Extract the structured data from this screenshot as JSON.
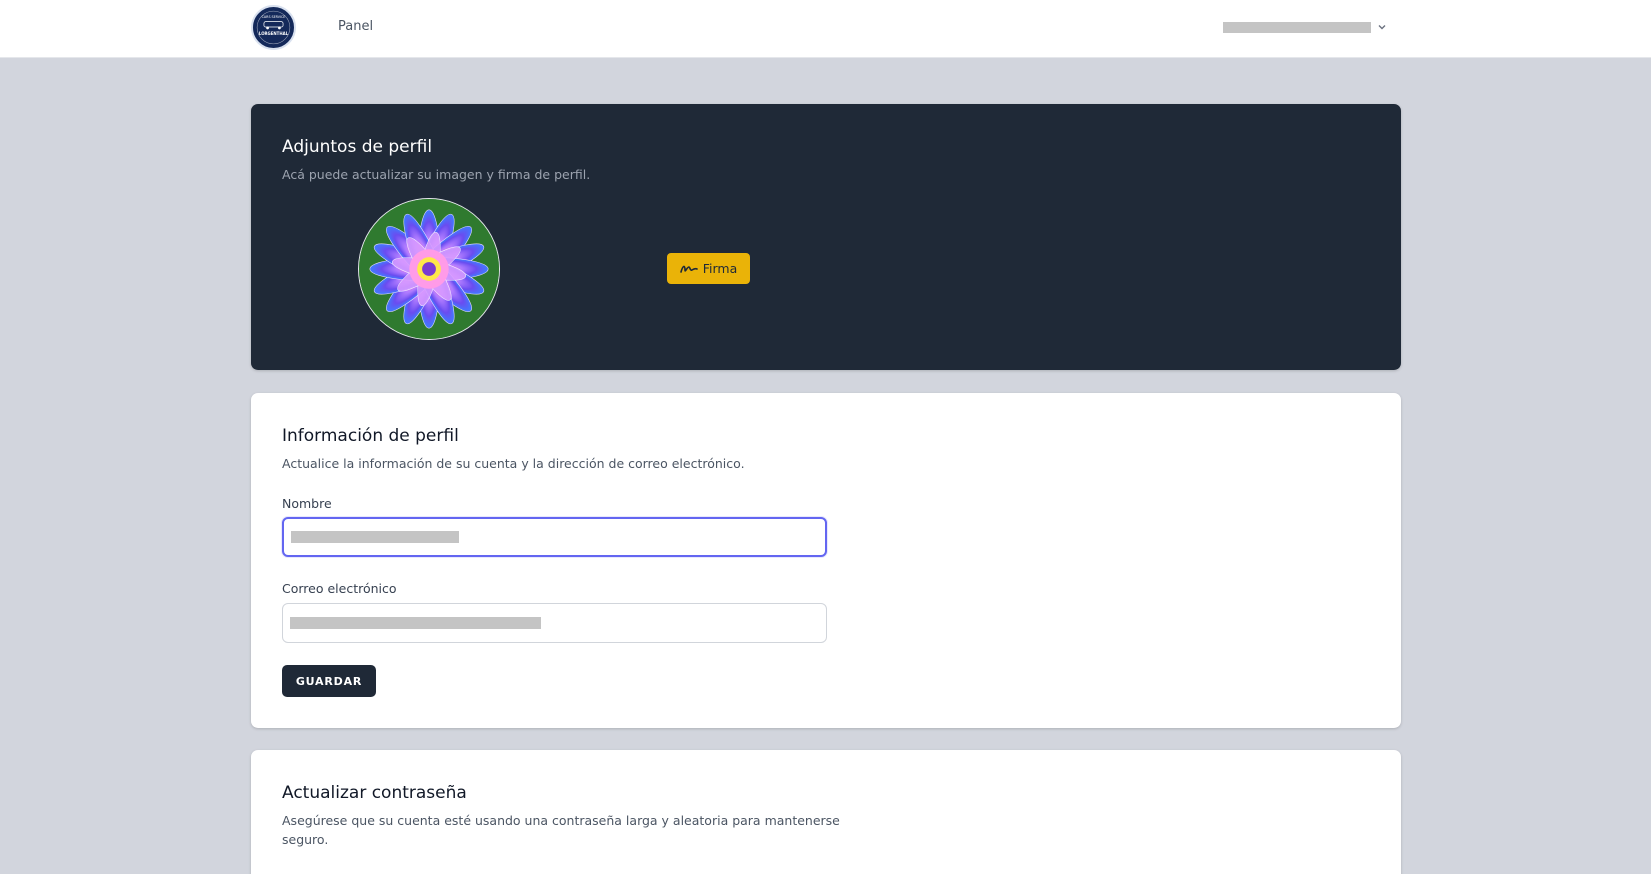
{
  "nav": {
    "logo_name": "logo-icon",
    "logo_text": "LORGENTHAL",
    "logo_subtext": "CARS SERVICE",
    "links": [
      "Panel"
    ],
    "user_menu_icon": "chevron-down-icon"
  },
  "attachments_card": {
    "title": "Adjuntos de perfil",
    "description": "Acá puede actualizar su imagen y firma de perfil.",
    "firma_button": "Firma",
    "firma_icon": "signature-icon"
  },
  "profile_card": {
    "title": "Información de perfil",
    "description": "Actualice la información de su cuenta y la dirección de correo electrónico.",
    "name_label": "Nombre",
    "email_label": "Correo electrónico",
    "save_button": "GUARDAR"
  },
  "password_card": {
    "title": "Actualizar contraseña",
    "description": "Asegúrese que su cuenta esté usando una contraseña larga y aleatoria para mantenerse seguro."
  },
  "colors": {
    "page_bg": "#d2d5dd",
    "dark_card": "#1f2937",
    "accent_yellow": "#eab308",
    "focus_ring": "#6366f1"
  }
}
